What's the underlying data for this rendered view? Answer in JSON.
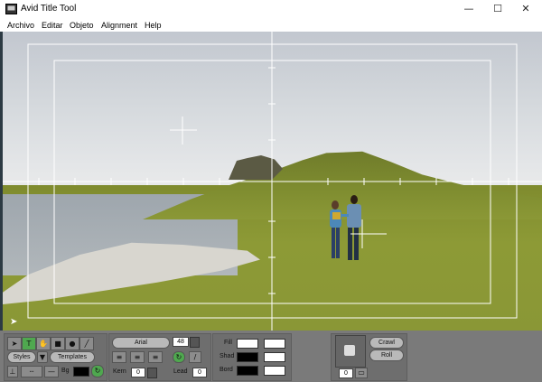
{
  "window": {
    "title": "Avid Title Tool",
    "controls": {
      "minimize": "—",
      "maximize": "☐",
      "close": "✕"
    }
  },
  "menu": [
    "Archivo",
    "Editar",
    "Objeto",
    "Alignment",
    "Help"
  ],
  "toolbar": {
    "styles_label": "Styles",
    "templates_label": "Templates",
    "font_name": "Arial",
    "font_size": "48",
    "bg_label": "Bg",
    "kern_label": "Kern",
    "kern_value": "0",
    "lead_label": "Lead",
    "lead_value": "0",
    "fill_label": "Fill",
    "shad_label": "Shad",
    "bord_label": "Bord",
    "crawl_label": "Crawl",
    "roll_label": "Roll",
    "frame_value": "0"
  },
  "colors": {
    "fill": "#ffffff",
    "shadow": "#000000",
    "border": "#000000",
    "bg": "#000000",
    "toolbar_bg": "#7a7a7a"
  },
  "icons": [
    "selection-arrow-icon",
    "text-tool-icon",
    "hand-icon",
    "rectangle-icon",
    "oval-icon",
    "line-icon"
  ]
}
